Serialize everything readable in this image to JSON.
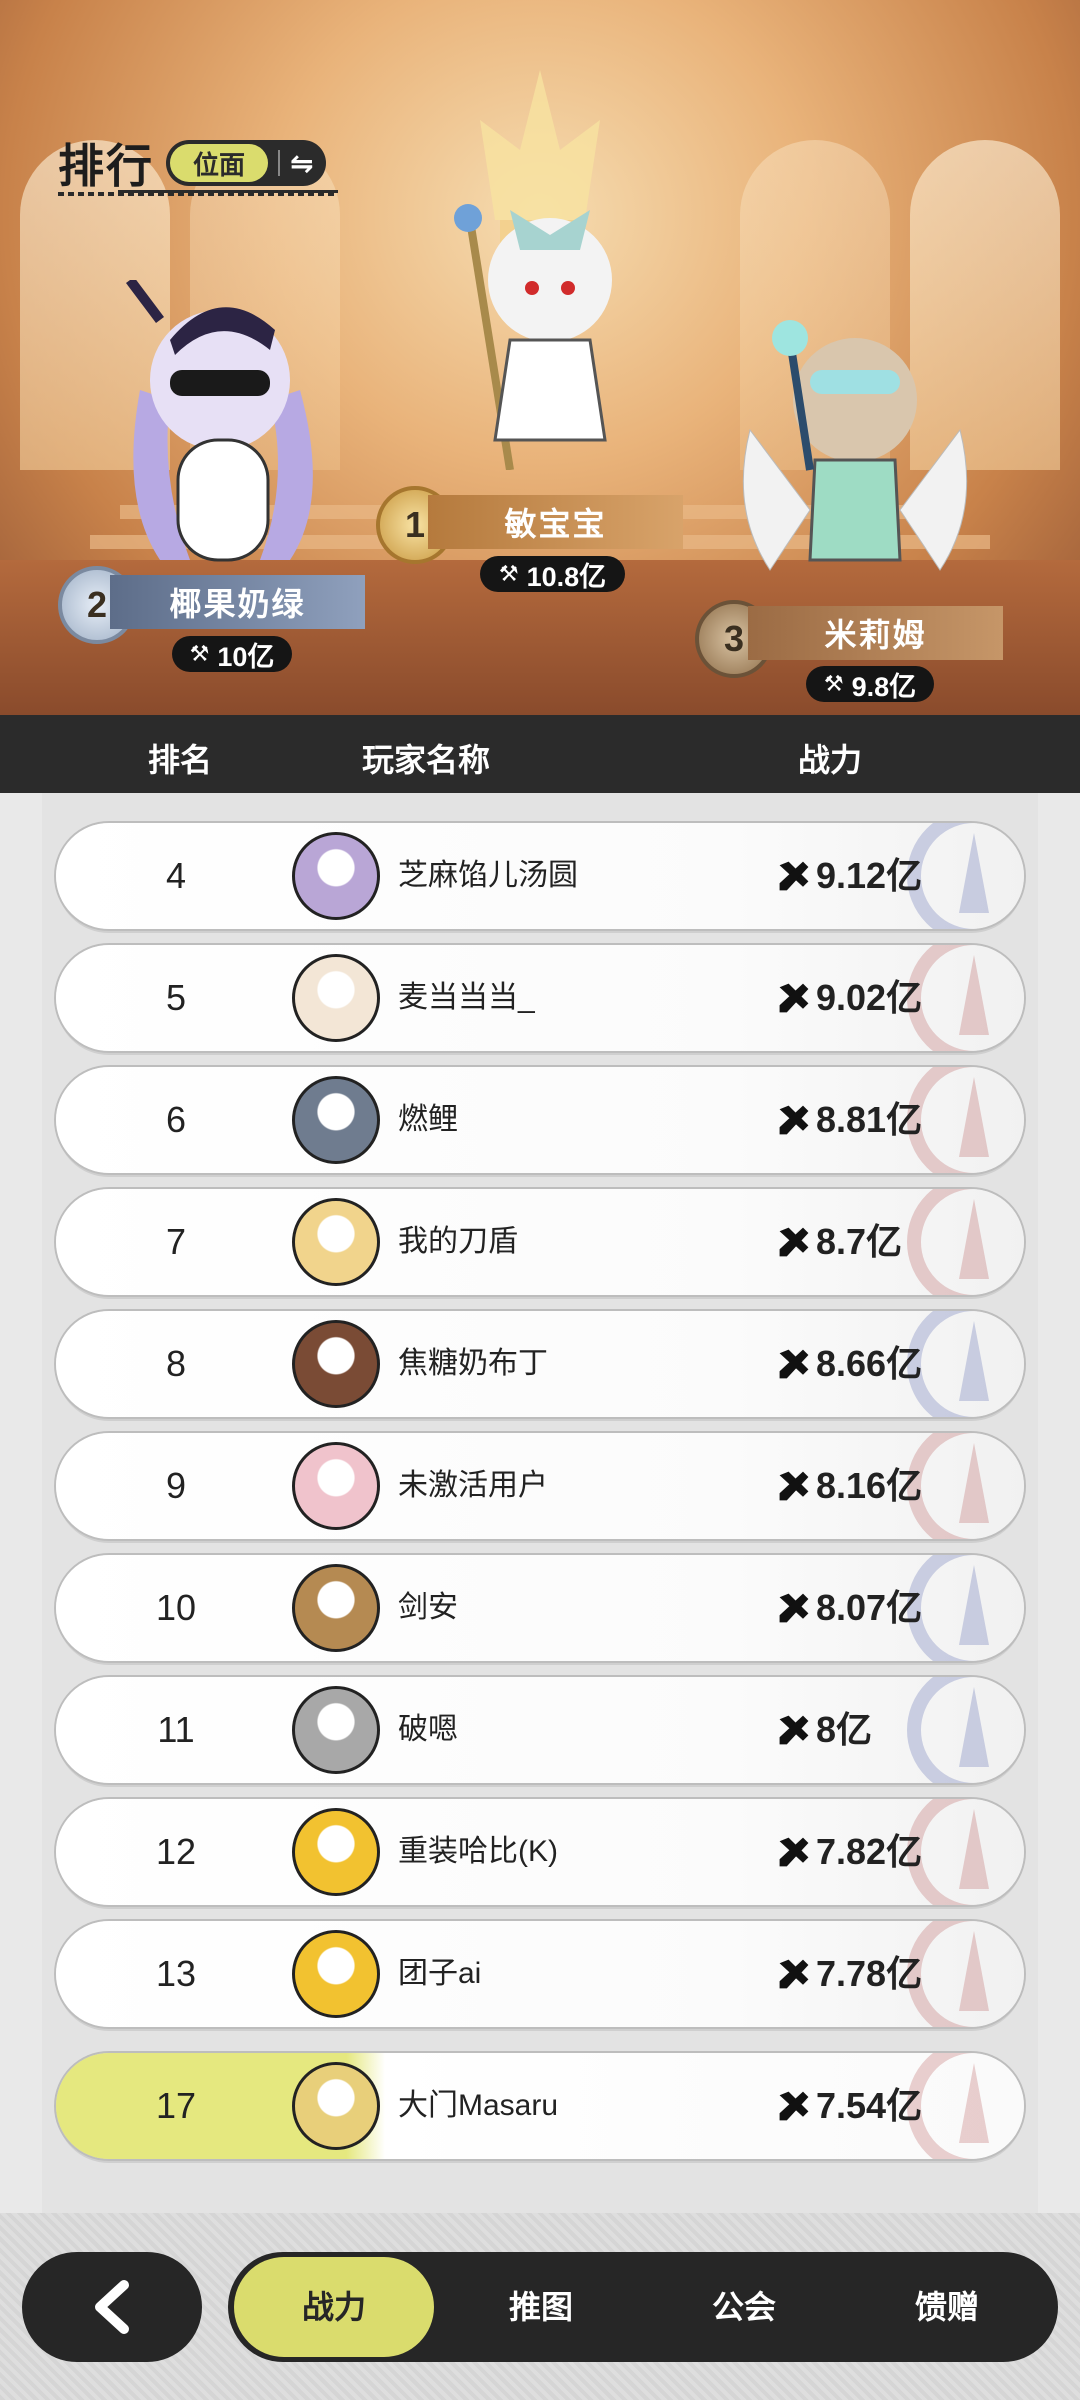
{
  "header": {
    "title": "排行",
    "scope_label": "位面"
  },
  "podium": [
    {
      "rank": "1",
      "name": "敏宝宝",
      "power": "10.8亿"
    },
    {
      "rank": "2",
      "name": "椰果奶绿",
      "power": "10亿"
    },
    {
      "rank": "3",
      "name": "米莉姆",
      "power": "9.8亿"
    }
  ],
  "table_header": {
    "rank": "排名",
    "player": "玩家名称",
    "power": "战力"
  },
  "rows": [
    {
      "rank": "4",
      "name": "芝麻馅儿汤圆",
      "power": "9.12亿",
      "avatar_color": "#b9a6d6",
      "crest_color": "#4a5aa8"
    },
    {
      "rank": "5",
      "name": "麦当当当_",
      "power": "9.02亿",
      "avatar_color": "#f3e6d6",
      "crest_color": "#b04a4a"
    },
    {
      "rank": "6",
      "name": "燃鲤",
      "power": "8.81亿",
      "avatar_color": "#6f7c8f",
      "crest_color": "#b04a4a"
    },
    {
      "rank": "7",
      "name": "我的刀盾",
      "power": "8.7亿",
      "avatar_color": "#f1d48c",
      "crest_color": "#b04a4a"
    },
    {
      "rank": "8",
      "name": "焦糖奶布丁",
      "power": "8.66亿",
      "avatar_color": "#7a4b35",
      "crest_color": "#4a5aa8"
    },
    {
      "rank": "9",
      "name": "未激活用户",
      "power": "8.16亿",
      "avatar_color": "#f0c3cc",
      "crest_color": "#b04a4a"
    },
    {
      "rank": "10",
      "name": "剑安",
      "power": "8.07亿",
      "avatar_color": "#b58a52",
      "crest_color": "#4a5aa8"
    },
    {
      "rank": "11",
      "name": "破嗯",
      "power": "8亿",
      "avatar_color": "#a8a8a8",
      "crest_color": "#4a5aa8"
    },
    {
      "rank": "12",
      "name": "重装哈比(K)",
      "power": "7.82亿",
      "avatar_color": "#f2c230",
      "crest_color": "#b04a4a"
    },
    {
      "rank": "13",
      "name": "团子ai",
      "power": "7.78亿",
      "avatar_color": "#f2c230",
      "crest_color": "#b04a4a"
    }
  ],
  "my_row": {
    "rank": "17",
    "name": "大门Masaru",
    "power": "7.54亿",
    "avatar_color": "#e8cf7a",
    "crest_color": "#b04a4a"
  },
  "nav": {
    "tabs": [
      "战力",
      "推图",
      "公会",
      "馈赠"
    ],
    "active_index": 0
  },
  "colors": {
    "accent": "#dadc6d",
    "dark": "#262626"
  }
}
